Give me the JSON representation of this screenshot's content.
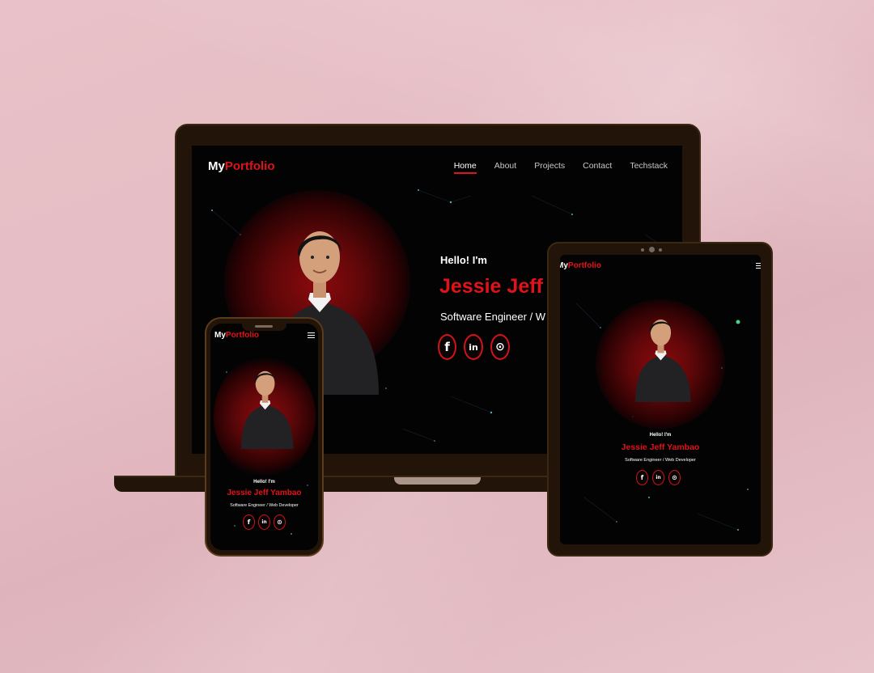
{
  "brand": {
    "my": "My",
    "portfolio": "Portfolio"
  },
  "nav": {
    "items": [
      "Home",
      "About",
      "Projects",
      "Contact",
      "Techstack"
    ],
    "active": "Home"
  },
  "hero": {
    "greeting": "Hello! I'm",
    "name": "Jessie Jeff Yambao",
    "name_laptop_visible": "Jessie Jeff",
    "role": "Software Engineer / Web Developer",
    "role_laptop_visible": "Software Engineer / W"
  },
  "social": [
    {
      "icon": "facebook-icon",
      "glyph": "f"
    },
    {
      "icon": "linkedin-icon",
      "glyph": "in"
    },
    {
      "icon": "github-icon",
      "glyph": "⊙"
    }
  ],
  "colors": {
    "accent": "#e0121a",
    "background": "#040304",
    "device_frame": "#221408",
    "backdrop": "#e6bec5"
  }
}
